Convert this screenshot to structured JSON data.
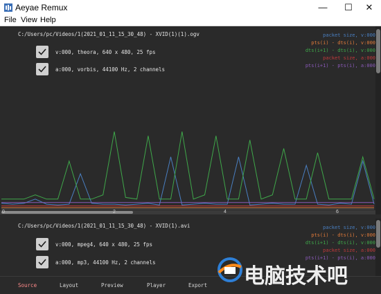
{
  "window": {
    "title": "Aeyae Remux",
    "minimize_glyph": "—",
    "maximize_glyph": "☐",
    "close_glyph": "✕"
  },
  "menu": {
    "file": "File",
    "view": "View",
    "help": "Help"
  },
  "file1": {
    "path": "C:/Users/pc/Videos/1(2021_01_11_15_30_48) - XVID(1)(1).ogv",
    "streams": [
      {
        "label": "v:000, theora, 640 x 480, 25 fps",
        "checked": true
      },
      {
        "label": "a:000, vorbis, 44100 Hz, 2 channels",
        "checked": true
      }
    ]
  },
  "file2": {
    "path": "C:/Users/pc/Videos/1(2021_01_11_15_30_48) - XVID(1).avi",
    "streams": [
      {
        "label": "v:000, mpeg4, 640 x 480, 25 fps",
        "checked": true
      },
      {
        "label": "a:000, mp3, 44100 Hz, 2 channels",
        "checked": true
      }
    ]
  },
  "legend": [
    {
      "text": "packet size, v:000",
      "color": "#4a7fc1"
    },
    {
      "text": "pts(i) - dts(i), v:000",
      "color": "#e07a3a"
    },
    {
      "text": "dts(i+1) - dts(i), v:000",
      "color": "#3fa84a"
    },
    {
      "text": "packet size, a:000",
      "color": "#c0393b"
    },
    {
      "text": "pts(i+1) - pts(i), a:000",
      "color": "#8a5ab8"
    }
  ],
  "axis_ticks": [
    "0",
    "2",
    "4",
    "6"
  ],
  "chart_data": {
    "type": "line",
    "x": [
      0,
      0.2,
      0.4,
      0.6,
      0.8,
      1,
      1.2,
      1.4,
      1.6,
      1.8,
      2,
      2.2,
      2.4,
      2.6,
      2.8,
      3,
      3.2,
      3.4,
      3.6,
      3.8,
      4,
      4.2,
      4.4,
      4.6,
      4.8,
      5,
      5.2,
      5.4,
      5.6,
      5.8,
      6,
      6.2,
      6.4,
      6.6
    ],
    "xticks": [
      "0",
      "2",
      "4",
      "6"
    ],
    "series": [
      {
        "name": "packet size, v:000",
        "color": "#4a7fc1",
        "values": [
          5,
          4,
          5,
          10,
          4,
          3,
          4,
          40,
          5,
          4,
          4,
          3,
          4,
          5,
          3,
          60,
          3,
          4,
          5,
          4,
          4,
          60,
          3,
          4,
          5,
          4,
          4,
          50,
          4,
          3,
          5,
          4,
          55,
          4
        ]
      },
      {
        "name": "pts(i) - dts(i), v:000",
        "color": "#e07a3a",
        "values": [
          0,
          0,
          0,
          0,
          0,
          0,
          0,
          0,
          0,
          0,
          0,
          0,
          0,
          0,
          0,
          0,
          0,
          0,
          0,
          0,
          0,
          0,
          0,
          0,
          0,
          0,
          0,
          0,
          0,
          0,
          0,
          0,
          0,
          0
        ]
      },
      {
        "name": "dts(i+1) - dts(i), v:000",
        "color": "#3fa84a",
        "values": [
          10,
          10,
          10,
          15,
          10,
          10,
          55,
          10,
          10,
          15,
          90,
          12,
          10,
          85,
          10,
          10,
          90,
          10,
          15,
          85,
          10,
          10,
          80,
          10,
          15,
          70,
          10,
          10,
          65,
          10,
          10,
          10,
          60,
          10
        ]
      },
      {
        "name": "packet size, a:000",
        "color": "#c0393b",
        "values": [
          2,
          2,
          2,
          2,
          2,
          2,
          2,
          2,
          2,
          2,
          2,
          2,
          2,
          2,
          2,
          2,
          2,
          2,
          2,
          2,
          2,
          2,
          2,
          2,
          2,
          2,
          2,
          2,
          2,
          2,
          2,
          2,
          2,
          2
        ]
      },
      {
        "name": "pts(i+1) - pts(i), a:000",
        "color": "#8a5ab8",
        "values": [
          6,
          6,
          6,
          6,
          6,
          6,
          6,
          6,
          6,
          6,
          6,
          6,
          6,
          6,
          6,
          6,
          6,
          6,
          6,
          6,
          6,
          6,
          6,
          6,
          6,
          6,
          6,
          6,
          6,
          6,
          6,
          6,
          6,
          6
        ]
      }
    ],
    "ylim": [
      0,
      100
    ],
    "grid": false,
    "legend_position": "top-right"
  },
  "tabs": [
    {
      "label": "Source",
      "active": true
    },
    {
      "label": "Layout",
      "active": false
    },
    {
      "label": "Preview",
      "active": false
    },
    {
      "label": "Player",
      "active": false
    },
    {
      "label": "Export",
      "active": false
    }
  ],
  "watermark": {
    "text": "电脑技术吧"
  },
  "colors": {
    "background": "#2a2a2a",
    "active_tab": "#ff8a8a",
    "text": "#e6e6e6"
  }
}
